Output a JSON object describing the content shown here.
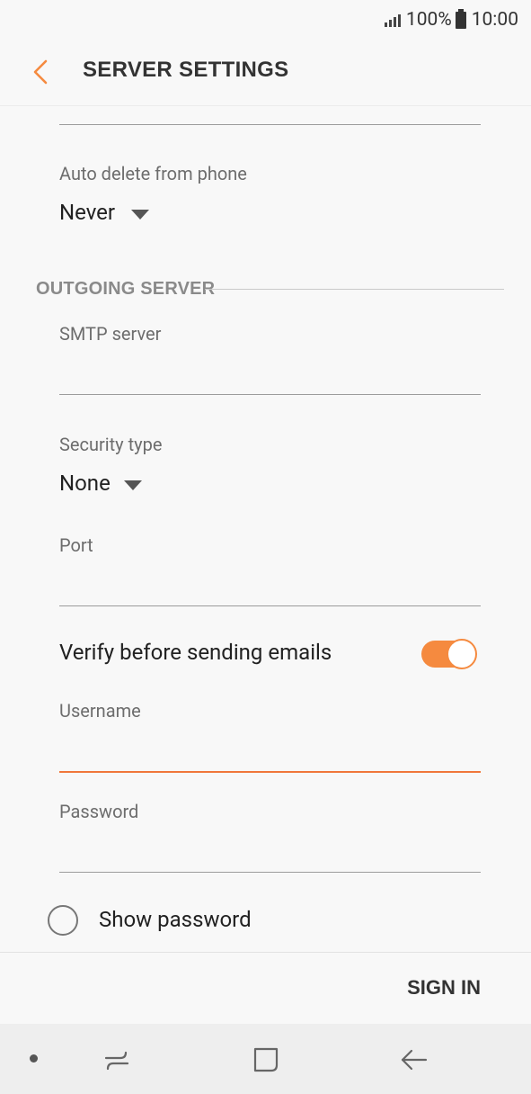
{
  "status_bar": {
    "battery": "100%",
    "time": "10:00",
    "icons": [
      "signal-icon",
      "battery-icon"
    ]
  },
  "app_bar": {
    "title": "SERVER SETTINGS",
    "back_icon": "chevron-left-icon",
    "accent_color": "#f58a3f"
  },
  "incoming": {
    "auto_delete_label": "Auto delete from phone",
    "auto_delete_value": "Never"
  },
  "outgoing": {
    "section_title": "OUTGOING SERVER",
    "smtp_label": "SMTP server",
    "smtp_value": "",
    "security_label": "Security type",
    "security_value": "None",
    "port_label": "Port",
    "port_value": "",
    "verify_label": "Verify before sending emails",
    "verify_on": true,
    "username_label": "Username",
    "username_value": "",
    "password_label": "Password",
    "password_value": "",
    "show_password_label": "Show password",
    "show_password_checked": false
  },
  "footer": {
    "sign_in_label": "SIGN IN"
  },
  "nav_bar": {
    "icons": [
      "dot-indicator-icon",
      "recent-apps-icon",
      "home-icon",
      "back-arrow-icon"
    ]
  }
}
